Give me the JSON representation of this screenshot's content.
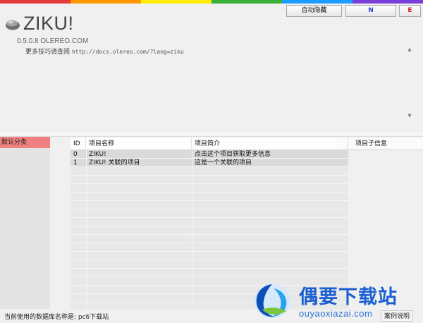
{
  "rainbow_colors": [
    "#e53a3a",
    "#ff9800",
    "#ffee00",
    "#38b03a",
    "#1e9cff",
    "#7a3fd8"
  ],
  "toolbar": {
    "auto_hide_label": "自动隐藏",
    "n_label": "N",
    "e_label": "E"
  },
  "app": {
    "title": "ZIKU!",
    "version": "0.5.0.8  OLEREO.COM",
    "info_prefix": "更多技巧请查阅 ",
    "info_url": "http://docs.olereo.com/?lang=ziku"
  },
  "categories": [
    "默认分类"
  ],
  "table": {
    "headers": [
      "ID",
      "项目名称",
      "项目简介"
    ],
    "rows": [
      {
        "id": "0",
        "name": "ZIKU!",
        "desc": "点击这个项目获取更多信息"
      },
      {
        "id": "1",
        "name": "ZIKU! 关联的项目",
        "desc": "这是一个关联的项目"
      }
    ]
  },
  "subinfo": {
    "header": "项目子信息"
  },
  "status": {
    "text": "当前使用的数据库名称是: pc6下载站",
    "button": "案例说明"
  },
  "watermark": {
    "title": "偶要下载站",
    "url": "ouyaoxiazai.com"
  },
  "colors": {
    "category_highlight": "#f08080",
    "n_button_text": "#2a3fd8",
    "e_button_text": "#d42020",
    "watermark_blue": "#1a5fd0"
  }
}
